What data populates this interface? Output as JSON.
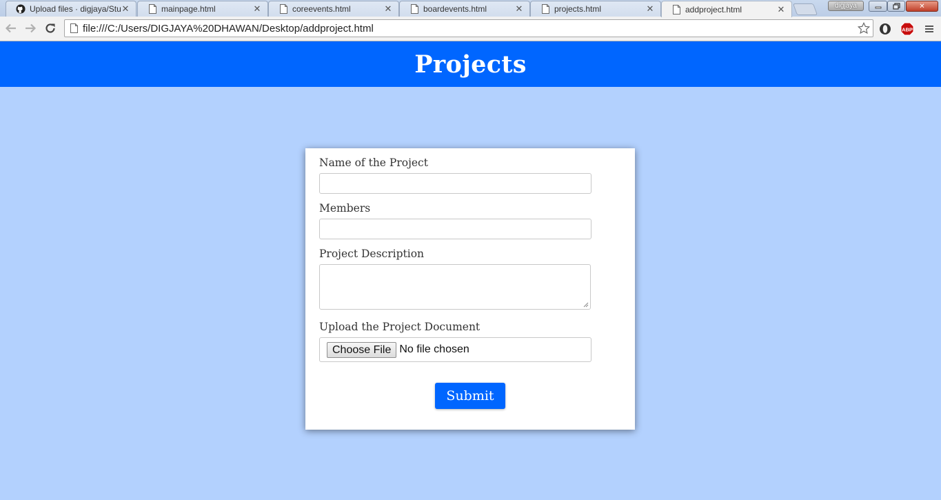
{
  "browser": {
    "tabs": [
      {
        "title": "Upload files · digjaya/Stu",
        "icon": "github-icon",
        "active": false
      },
      {
        "title": "mainpage.html",
        "icon": "page-icon",
        "active": false
      },
      {
        "title": "coreevents.html",
        "icon": "page-icon",
        "active": false
      },
      {
        "title": "boardevents.html",
        "icon": "page-icon",
        "active": false
      },
      {
        "title": "projects.html",
        "icon": "page-icon",
        "active": false
      },
      {
        "title": "addproject.html",
        "icon": "page-icon",
        "active": true
      }
    ],
    "profile_name": "digjaya",
    "url": "file:///C:/Users/DIGJAYA%20DHAWAN/Desktop/addproject.html",
    "adblock_label": "ABP"
  },
  "page": {
    "title": "Projects",
    "form": {
      "name_label": "Name of the Project",
      "name_value": "",
      "members_label": "Members",
      "members_value": "",
      "description_label": "Project Description",
      "description_value": "",
      "upload_label": "Upload the Project Document",
      "choose_file_label": "Choose File",
      "no_file_text": "No file chosen",
      "submit_label": "Submit"
    }
  },
  "colors": {
    "header_bg": "#0066ff",
    "page_bg": "#b3d1fe",
    "submit_bg": "#0066ff"
  }
}
